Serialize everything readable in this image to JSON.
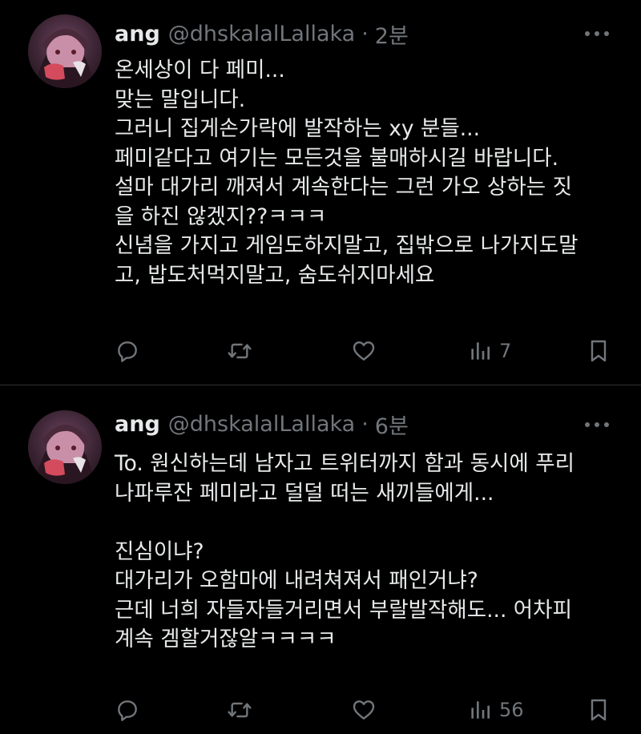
{
  "tweets": [
    {
      "author_name": "ang",
      "author_handle": "@dhskalalLallaka",
      "separator": "·",
      "time": "2분",
      "lines": [
        "온세상이 다 페미...",
        "맞는 말입니다.",
        "그러니 집게손가락에 발작하는 xy 분들...",
        "페미같다고 여기는 모든것을 불매하시길 바랍니다.",
        "설마 대가리 깨져서 계속한다는 그런 가오 상하는 짓",
        "을 하진 않겠지??ㅋㅋㅋ",
        "신념을 가지고 게임도하지말고, 집밖으로 나가지도말",
        "고, 밥도처먹지말고, 숨도쉬지마세요"
      ],
      "views": "7"
    },
    {
      "author_name": "ang",
      "author_handle": "@dhskalalLallaka",
      "separator": "·",
      "time": "6분",
      "lines": [
        "To. 원신하는데 남자고 트위터까지 함과 동시에 푸리",
        "나파루잔 페미라고 덜덜 떠는 새끼들에게...",
        "",
        "진심이냐?",
        "대가리가 오함마에 내려쳐져서 패인거냐?",
        "근데 너희 자들자들거리면서 부랄발작해도... 어차피",
        "계속 겜할거잖알ㅋㅋㅋㅋ"
      ],
      "views": "56"
    }
  ],
  "icons": {
    "reply": "reply-icon",
    "retweet": "retweet-icon",
    "like": "heart-icon",
    "views": "views-icon",
    "bookmark": "bookmark-icon",
    "more": "more-icon"
  },
  "colors": {
    "background": "#000000",
    "text": "#e7e9ea",
    "secondary": "#71767b",
    "divider": "#2f3336"
  }
}
